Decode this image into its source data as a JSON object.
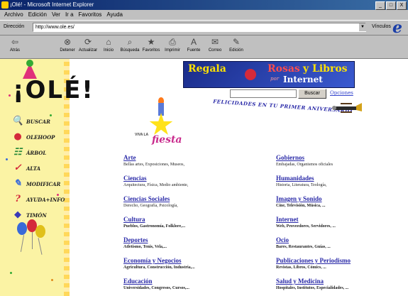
{
  "window": {
    "title": "¡Olé! - Microsoft Internet Explorer",
    "buttons": [
      "_",
      "□",
      "X"
    ]
  },
  "menu": [
    "Archivo",
    "Edición",
    "Ver",
    "Ir a",
    "Favoritos",
    "Ayuda"
  ],
  "address": {
    "label": "Dirección",
    "url": "http://www.ole.es/",
    "vinculos": "Vínculos"
  },
  "toolbar": [
    {
      "label": "Atrás",
      "icon": "⇦"
    },
    {
      "label": "Detener",
      "icon": "⊗"
    },
    {
      "label": "Actualizar",
      "icon": "⟳"
    },
    {
      "label": "Inicio",
      "icon": "⌂"
    },
    {
      "label": "Búsqueda",
      "icon": "⌕"
    },
    {
      "label": "Favoritos",
      "icon": "★"
    },
    {
      "label": "Imprimir",
      "icon": "⎙"
    },
    {
      "label": "Fuente",
      "icon": "A"
    },
    {
      "label": "Correo",
      "icon": "✉"
    },
    {
      "label": "Edición",
      "icon": "✎"
    }
  ],
  "sidebar": {
    "logo": "¡OLÉ!",
    "items": [
      {
        "label": "BUSCAR",
        "icon": "🔍"
      },
      {
        "label": "OLEHOOP",
        "icon": "●"
      },
      {
        "label": "ÁRBOL",
        "icon": "☷"
      },
      {
        "label": "ALTA",
        "icon": "✓"
      },
      {
        "label": "MODIFICAR",
        "icon": "✎"
      },
      {
        "label": "AYUDA+INFO",
        "icon": "?"
      },
      {
        "label": "TIMÓN",
        "icon": "◆"
      }
    ]
  },
  "banner": {
    "regala": "Regala",
    "rosas": "Rosas",
    "y_libros": "y Libros",
    "por": "por",
    "internet": "Internet"
  },
  "search": {
    "button": "Buscar",
    "opciones": "Opciones"
  },
  "anniversary": "FELICIDADES EN TU PRIMER ANIVERSARIO",
  "fiesta": {
    "viva_la": "VIVA LA",
    "fiesta": "fiesta"
  },
  "categories_left": [
    {
      "title": "Arte",
      "sub": "Bellas artes, Exposiciones, Museos,",
      "bold": false
    },
    {
      "title": "Ciencias",
      "sub": "Arquitectura, Física, Medio ambiente,",
      "bold": false
    },
    {
      "title": "Ciencias Sociales",
      "sub": "Derecho, Geografía, Psicología,",
      "bold": false
    },
    {
      "title": "Cultura",
      "sub": "Pueblos, Gastronomía, Folklore,...",
      "bold": true
    },
    {
      "title": "Deportes",
      "sub": "Atletismo, Tenis, Vela,...",
      "bold": true
    },
    {
      "title": "Economía y Negocios",
      "sub": "Agricultura, Construcción, Industria,...",
      "bold": true
    },
    {
      "title": "Educación",
      "sub": "Universidades, Congresos, Cursos,...",
      "bold": true
    }
  ],
  "categories_right": [
    {
      "title": "Gobiernos",
      "sub": "Embajadas, Organismos oficiales",
      "bold": false
    },
    {
      "title": "Humanidades",
      "sub": "Historia, Literatura, Teología,",
      "bold": false
    },
    {
      "title": "Imagen y Sonido",
      "sub": "Cine, Televisión, Música, ...",
      "bold": true
    },
    {
      "title": "Internet",
      "sub": "Web, Proveedores, Servidores, ...",
      "bold": true
    },
    {
      "title": "Ocio",
      "sub": "Bares, Restaurantes, Guías, ...",
      "bold": true
    },
    {
      "title": "Publicaciones y Periodismo",
      "sub": "Revistas, Libros, Cómics, ...",
      "bold": true
    },
    {
      "title": "Salud y Medicina",
      "sub": "Hospitales, Institutos, Especialidades, ...",
      "bold": true
    }
  ],
  "colors": {
    "title_bar": "#0a246a",
    "link": "#2a2aa8",
    "sidebar_bg": "#fbf3a4"
  }
}
